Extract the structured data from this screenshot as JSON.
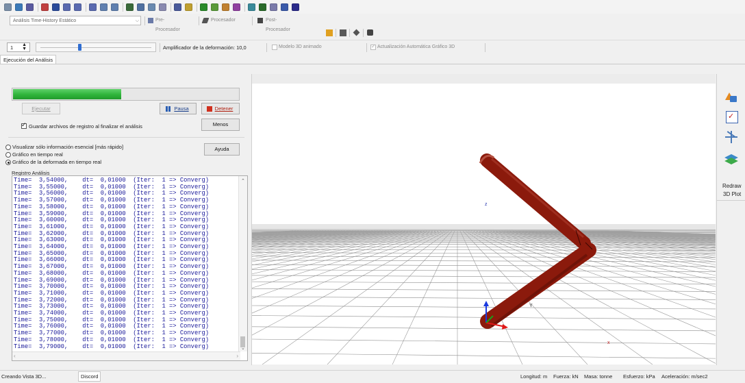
{
  "toolbar": {
    "icons": [
      "cursor-icon",
      "snap-icon",
      "layers-icon",
      "flag-icon",
      "save-icon",
      "grid-icon",
      "grid2-icon",
      "grid3-icon",
      "undo-icon",
      "redo-icon",
      "model-icon",
      "table-icon",
      "ruler-icon",
      "box-icon",
      "gear-icon",
      "star-icon",
      "check-icon",
      "globe-icon",
      "plant-icon",
      "shape-icon",
      "mesh-icon",
      "tree-icon",
      "tag-icon",
      "curve-icon",
      "sphere-icon"
    ],
    "icon_colors": [
      "#7a8fa8",
      "#3c7ab8",
      "#5a5aa0",
      "#c04040",
      "#2a4a9a",
      "#5a6ab0",
      "#5a6ab0",
      "#5a6ab0",
      "#6080b0",
      "#6080b0",
      "#3a6a3a",
      "#5070a0",
      "#6a8ab0",
      "#8a8ab0",
      "#4a5a9a",
      "#c0a030",
      "#2a8a2a",
      "#5a9a3a",
      "#c08030",
      "#9040a0",
      "#3a8a9a",
      "#2a6a2a",
      "#7a7aaa",
      "#3a5aaa",
      "#2a2a8a"
    ]
  },
  "analysis_type": {
    "value": "Análisis Time-History Estático"
  },
  "workflow": {
    "pre": "Pre-Procesador",
    "proc": "Procesador",
    "post": "Post-Procesador"
  },
  "row3": {
    "spin_value": "1",
    "amp_label": "Amplificador de la deformación: 10,0",
    "modelo_label": "Modelo 3D animado",
    "auto_label": "Actualización Automática Gráfico 3D",
    "slider_level": 0.35
  },
  "tab": {
    "label": "Ejecución del Análisis"
  },
  "panel": {
    "progress": 0.48,
    "ejecutar": "Ejecutar",
    "pausa": "Pausa",
    "detener": "Detener",
    "guardar": "Guardar archivos de registro al finalizar el análisis",
    "menos": "Menos",
    "opt1": "Visualizar sólo información esencial [más rápido]",
    "opt2": "Gráfico en tiempo real",
    "opt3": "Gráfico de la deformada en tiempo real",
    "ayuda": "Ayuda",
    "registro": "Registro Análisis"
  },
  "log": [
    "Time=  3,54000,    dt=  0,01000  (Iter:  1 => Converg)",
    "Time=  3,55000,    dt=  0,01000  (Iter:  1 => Converg)",
    "Time=  3,56000,    dt=  0,01000  (Iter:  1 => Converg)",
    "Time=  3,57000,    dt=  0,01000  (Iter:  1 => Converg)",
    "Time=  3,58000,    dt=  0,01000  (Iter:  1 => Converg)",
    "Time=  3,59000,    dt=  0,01000  (Iter:  1 => Converg)",
    "Time=  3,60000,    dt=  0,01000  (Iter:  1 => Converg)",
    "Time=  3,61000,    dt=  0,01000  (Iter:  1 => Converg)",
    "Time=  3,62000,    dt=  0,01000  (Iter:  1 => Converg)",
    "Time=  3,63000,    dt=  0,01000  (Iter:  1 => Converg)",
    "Time=  3,64000,    dt=  0,01000  (Iter:  1 => Converg)",
    "Time=  3,65000,    dt=  0,01000  (Iter:  1 => Converg)",
    "Time=  3,66000,    dt=  0,01000  (Iter:  1 => Converg)",
    "Time=  3,67000,    dt=  0,01000  (Iter:  1 => Converg)",
    "Time=  3,68000,    dt=  0,01000  (Iter:  1 => Converg)",
    "Time=  3,69000,    dt=  0,01000  (Iter:  1 => Converg)",
    "Time=  3,70000,    dt=  0,01000  (Iter:  1 => Converg)",
    "Time=  3,71000,    dt=  0,01000  (Iter:  1 => Converg)",
    "Time=  3,72000,    dt=  0,01000  (Iter:  1 => Converg)",
    "Time=  3,73000,    dt=  0,01000  (Iter:  1 => Converg)",
    "Time=  3,74000,    dt=  0,01000  (Iter:  1 => Converg)",
    "Time=  3,75000,    dt=  0,01000  (Iter:  1 => Converg)",
    "Time=  3,76000,    dt=  0,01000  (Iter:  1 => Converg)",
    "Time=  3,77000,    dt=  0,01000  (Iter:  1 => Converg)",
    "Time=  3,78000,    dt=  0,01000  (Iter:  1 => Converg)",
    "Time=  3,79000,    dt=  0,01000  (Iter:  1 => Converg)"
  ],
  "view3d": {
    "axis_z": "z",
    "axis_y": "Y",
    "axis_x": "x",
    "beam_color": "#8b1a0c",
    "sky_color": "#ffffff"
  },
  "side": {
    "redraw": "Redraw",
    "plot3d": "3D Plot"
  },
  "status": {
    "left": "Creando Vista 3D...",
    "discord": "Discord",
    "longitud": "Longitud: m",
    "fuerza": "Fuerza: kN",
    "masa": "Masa: tonne",
    "esfuerzo": "Esfuerzo: kPa",
    "aceleracion": "Aceleración: m/sec2"
  },
  "colors": {
    "progress": "#2fb43a",
    "stop": "#d0301e",
    "pause": "#2b5fb3"
  }
}
